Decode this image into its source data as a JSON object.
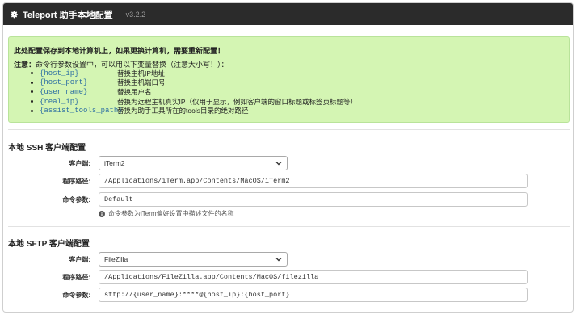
{
  "window": {
    "title": "Teleport 助手本地配置",
    "version": "v3.2.2",
    "icon": "gear-icon"
  },
  "notice": {
    "heading": "此处配置保存到本地计算机上，如果更换计算机，需要重新配置！",
    "note_label": "注意：",
    "note_text": "命令行参数设置中，可以用以下变量替换（注意大小写！）：",
    "variables": [
      {
        "code": "{host_ip}",
        "desc": "替换主机IP地址"
      },
      {
        "code": "{host_port}",
        "desc": "替换主机端口号"
      },
      {
        "code": "{user_name}",
        "desc": "替换用户名"
      },
      {
        "code": "{real_ip}",
        "desc": "替换为远程主机真实IP（仅用于显示，例如客户端的窗口标题或标签页标题等）"
      },
      {
        "code": "{assist_tools_path}",
        "desc": "替换为助手工具所在的tools目录的绝对路径"
      }
    ],
    "bg_color": "#d4f5b3"
  },
  "ssh": {
    "section_title": "本地 SSH 客户端配置",
    "client_label": "客户端:",
    "client_value": "iTerm2",
    "path_label": "程序路径:",
    "path_value": "/Applications/iTerm.app/Contents/MacOS/iTerm2",
    "args_label": "命令参数:",
    "args_value": "Default",
    "help_text": "命令参数为iTerm偏好设置中描述文件的名称",
    "help_icon": "info-icon"
  },
  "sftp": {
    "section_title": "本地 SFTP 客户端配置",
    "client_label": "客户端:",
    "client_value": "FileZilla",
    "path_label": "程序路径:",
    "path_value": "/Applications/FileZilla.app/Contents/MacOS/filezilla",
    "args_label": "命令参数:",
    "args_value": "sftp://{user_name}:****@{host_ip}:{host_port}"
  }
}
